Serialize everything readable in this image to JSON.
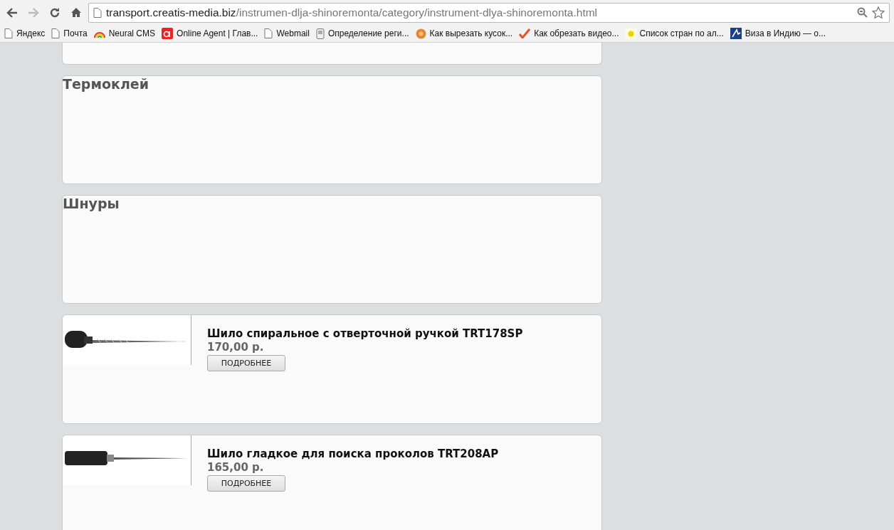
{
  "browser": {
    "url_host": "transport.creatis-media.biz",
    "url_path": "/instrumen-dlja-shinoremonta/category/instrument-dlya-shinoremonta.html",
    "forward_disabled": true
  },
  "bookmarks": [
    {
      "label": "Яндекс",
      "kind": "page"
    },
    {
      "label": "Почта",
      "kind": "page"
    },
    {
      "label": "Neural CMS",
      "kind": "rainbow"
    },
    {
      "label": "Online Agent | Глав...",
      "kind": "alpha"
    },
    {
      "label": "Webmail",
      "kind": "page"
    },
    {
      "label": "Определение реги...",
      "kind": "phone"
    },
    {
      "label": "Как вырезать кусок...",
      "kind": "disc"
    },
    {
      "label": "Как обрезать видео...",
      "kind": "check"
    },
    {
      "label": "Список стран по ал...",
      "kind": "sun"
    },
    {
      "label": "Виза в Индию — о...",
      "kind": "visa"
    }
  ],
  "categories": [
    {
      "title": "Термоклей"
    },
    {
      "title": "Шнуры"
    }
  ],
  "products": [
    {
      "name": "Шило спиральное с отверточной ручкой TRT178SP",
      "price": "170,00 р.",
      "button": "ПОДРОБНЕЕ",
      "kind": "spiral"
    },
    {
      "name": "Шило гладкое для поиска проколов TRT208AP",
      "price": "165,00 р.",
      "button": "ПОДРОБНЕЕ",
      "kind": "smooth"
    }
  ]
}
